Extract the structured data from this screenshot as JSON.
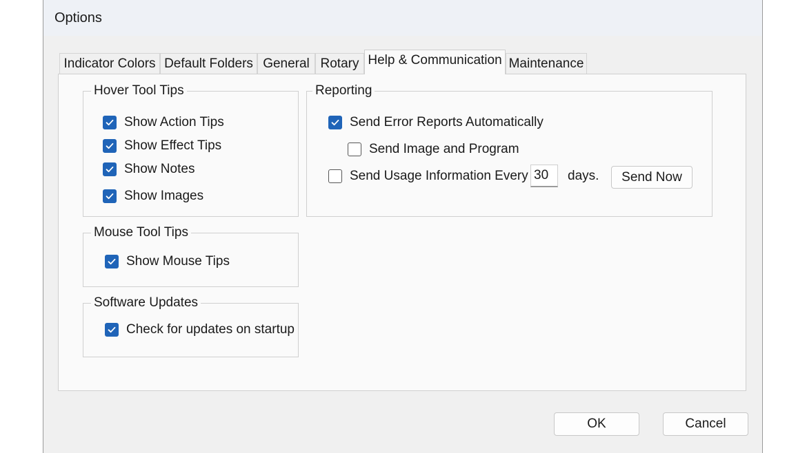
{
  "window": {
    "title": "Options"
  },
  "tabs": [
    {
      "label": "Indicator Colors",
      "active": false
    },
    {
      "label": "Default Folders",
      "active": false
    },
    {
      "label": "General",
      "active": false
    },
    {
      "label": "Rotary",
      "active": false
    },
    {
      "label": "Help & Communication",
      "active": true
    },
    {
      "label": "Maintenance",
      "active": false
    }
  ],
  "hover_tool_tips": {
    "title": "Hover Tool Tips",
    "items": [
      {
        "label": "Show Action Tips",
        "checked": true
      },
      {
        "label": "Show Effect Tips",
        "checked": true
      },
      {
        "label": "Show Notes",
        "checked": true
      },
      {
        "label": "Show Images",
        "checked": true
      }
    ]
  },
  "mouse_tool_tips": {
    "title": "Mouse Tool Tips",
    "items": [
      {
        "label": "Show Mouse Tips",
        "checked": true
      }
    ]
  },
  "software_updates": {
    "title": "Software Updates",
    "items": [
      {
        "label": "Check for updates on startup",
        "checked": true
      }
    ]
  },
  "reporting": {
    "title": "Reporting",
    "send_error_reports": {
      "label": "Send Error Reports Automatically",
      "checked": true
    },
    "send_image_program": {
      "label": "Send Image and Program",
      "checked": false
    },
    "send_usage": {
      "label": "Send Usage Information Every",
      "checked": false
    },
    "days_value": "30",
    "days_label": "days.",
    "send_now_label": "Send Now"
  },
  "footer": {
    "ok_label": "OK",
    "cancel_label": "Cancel"
  },
  "colors": {
    "checkbox_accent": "#1f64b8",
    "dialog_bg": "#f0f0f0",
    "panel_bg": "#fafafa"
  }
}
